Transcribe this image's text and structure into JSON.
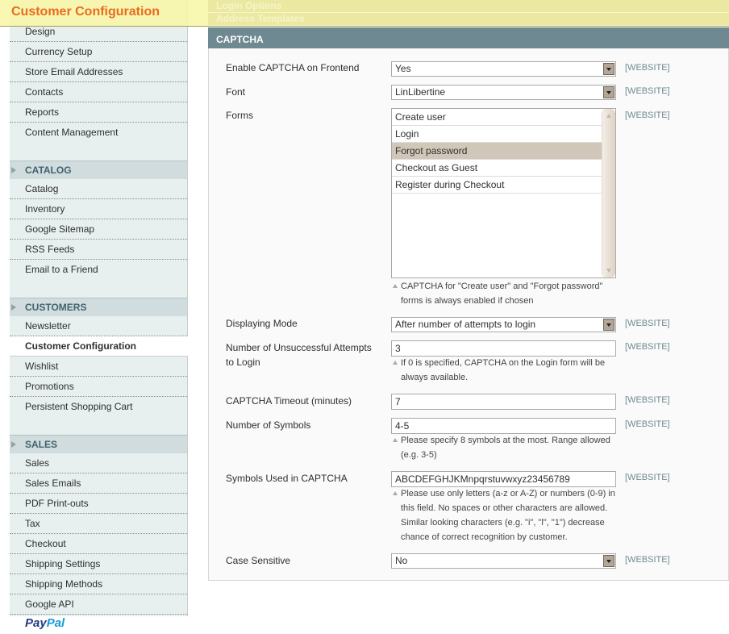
{
  "header": {
    "title": "Customer Configuration",
    "ghost_tabs": [
      "Login Options",
      "Address Templates"
    ]
  },
  "sidebar": {
    "top_items": [
      "Design",
      "Currency Setup",
      "Store Email Addresses",
      "Contacts",
      "Reports",
      "Content Management"
    ],
    "groups": [
      {
        "label": "CATALOG",
        "items": [
          "Catalog",
          "Inventory",
          "Google Sitemap",
          "RSS Feeds",
          "Email to a Friend"
        ]
      },
      {
        "label": "CUSTOMERS",
        "items": [
          "Newsletter",
          "Customer Configuration",
          "Wishlist",
          "Promotions",
          "Persistent Shopping Cart"
        ],
        "active": "Customer Configuration"
      },
      {
        "label": "SALES",
        "items": [
          "Sales",
          "Sales Emails",
          "PDF Print-outs",
          "Tax",
          "Checkout",
          "Shipping Settings",
          "Shipping Methods",
          "Google API"
        ]
      }
    ],
    "paypal": {
      "pay": "Pay",
      "pal": "Pal"
    }
  },
  "section": {
    "title": "CAPTCHA",
    "scope_label": "[WEBSITE]",
    "fields": {
      "enable": {
        "label": "Enable CAPTCHA on Frontend",
        "value": "Yes"
      },
      "font": {
        "label": "Font",
        "value": "LinLibertine"
      },
      "forms": {
        "label": "Forms",
        "options": [
          "Create user",
          "Login",
          "Forgot password",
          "Checkout as Guest",
          "Register during Checkout"
        ],
        "selected": [
          "Forgot password"
        ],
        "note": "CAPTCHA for \"Create user\" and \"Forgot password\" forms is always enabled if chosen"
      },
      "mode": {
        "label": "Displaying Mode",
        "value": "After number of attempts to login"
      },
      "attempts": {
        "label": "Number of Unsuccessful Attempts to Login",
        "value": "3",
        "note": "If 0 is specified, CAPTCHA on the Login form will be always available."
      },
      "timeout": {
        "label": "CAPTCHA Timeout (minutes)",
        "value": "7"
      },
      "symbols_count": {
        "label": "Number of Symbols",
        "value": "4-5",
        "note": "Please specify 8 symbols at the most. Range allowed (e.g. 3-5)"
      },
      "symbols_used": {
        "label": "Symbols Used in CAPTCHA",
        "value": "ABCDEFGHJKMnpqrstuvwxyz23456789",
        "note": "Please use only letters (a-z or A-Z) or numbers (0-9) in this field. No spaces or other characters are allowed. Similar looking characters (e.g. \"i\", \"l\", \"1\") decrease chance of correct recognition by customer."
      },
      "case_sensitive": {
        "label": "Case Sensitive",
        "value": "No"
      }
    }
  }
}
